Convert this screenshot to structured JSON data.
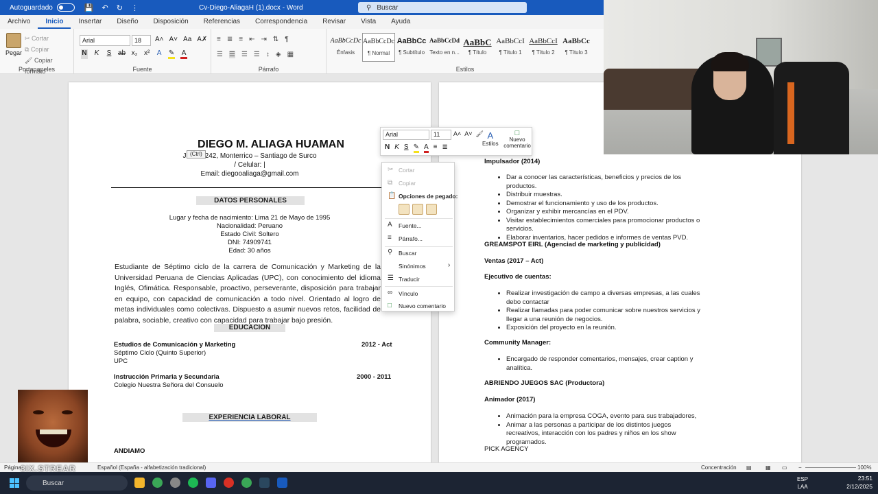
{
  "titlebar": {
    "autosave_label": "Autoguardado",
    "doc_title": "Cv-Diego-AliagaH (1).docx  -  Word",
    "search_placeholder": "Buscar"
  },
  "tabs": [
    "Archivo",
    "Inicio",
    "Insertar",
    "Diseño",
    "Disposición",
    "Referencias",
    "Correspondencia",
    "Revisar",
    "Vista",
    "Ayuda"
  ],
  "active_tab": "Inicio",
  "ribbon": {
    "clipboard": {
      "paste": "Pegar",
      "cut": "Cortar",
      "copy": "Copiar",
      "format_painter": "Copiar formato",
      "label": "Portapapeles"
    },
    "font": {
      "name": "Arial",
      "size": "18",
      "label": "Fuente",
      "buttons": [
        "N",
        "K",
        "S",
        "ab",
        "x₂",
        "x²",
        "A",
        "A"
      ]
    },
    "paragraph": {
      "label": "Párrafo"
    },
    "styles": {
      "label": "Estilos",
      "items": [
        {
          "preview": "AaBbCcDc",
          "name": "Énfasis"
        },
        {
          "preview": "AaBbCcDc",
          "name": "¶ Normal"
        },
        {
          "preview": "AaBbCc",
          "name": "¶ Subtítulo"
        },
        {
          "preview": "AaBbCcDd",
          "name": "Texto en n..."
        },
        {
          "preview": "AaBbC",
          "name": "¶ Título"
        },
        {
          "preview": "AaBbCcI",
          "name": "¶ Título 1"
        },
        {
          "preview": "AaBbCcI",
          "name": "¶ Título 2"
        },
        {
          "preview": "AaBbCc",
          "name": "¶ Título 3"
        }
      ]
    }
  },
  "page1": {
    "name": "DIEGO M. ALIAGA HUAMAN",
    "address": "Jr. ...in 242, Monterrico – Santiago de Surco",
    "phone": "/ Celular: |",
    "email": "Email: diegooaliaga@gmail.com",
    "datos_title": "DATOS PERSONALES",
    "datos": [
      "Lugar y fecha de nacimiento: Lima 21 de Mayo de 1995",
      "Nacionalidad: Peruano",
      "Estado Civil: Soltero",
      "DNI: 74909741",
      "Edad: 30 años"
    ],
    "profile": "Estudiante de Séptimo ciclo de la carrera de Comunicación y Marketing de la Universidad Peruana de Ciencias Aplicadas (UPC), con conocimiento del idioma Inglés, Ofimática. Responsable, proactivo, perseverante, disposición para trabajar en equipo, con capacidad de comunicación a todo nivel. Orientado al logro de metas individuales como colectivas. Dispuesto a asumir nuevos retos, facilidad de palabra, sociable, creativo con capacidad para trabajar bajo presión.",
    "educacion_title": "EDUCACION",
    "edu1": {
      "title": "Estudios de Comunicación y Marketing",
      "years": "2012 - Act",
      "line2": "Séptimo Ciclo (Quinto Superior)",
      "line3": "UPC"
    },
    "edu2": {
      "title": "Instrucción Primaria y Secundaria",
      "years": "2000 - 2011",
      "line2": "Colegio Nuestra Señora del Consuelo"
    },
    "experiencia_title": "EXPERIENCIA  LABORAL",
    "andiamo": "ANDIAMO"
  },
  "page2": {
    "impulsador": "Impulsador (2014)",
    "impulsador_items": [
      "Dar a conocer las características, beneficios y precios de los productos.",
      "Distribuir muestras.",
      "Demostrar el funcionamiento y uso de los productos.",
      "Organizar y exhibir mercancías en el PDV.",
      "Visitar establecimientos comerciales para promocionar productos o servicios.",
      "Elaborar inventarios, hacer pedidos e informes de ventas PVD."
    ],
    "greamspot": "GREAMSPOT EIRL (Agenciad de marketing y publicidad)",
    "ventas": "Ventas (2017 – Act)",
    "ejecutivo": "Ejecutivo de cuentas:",
    "ejecutivo_items": [
      "Realizar investigación de campo a diversas empresas, a las cuales debo contactar",
      "Realizar llamadas para poder comunicar sobre nuestros servicios y llegar a una reunión de negocios.",
      "Exposición del proyecto en la reunión."
    ],
    "community": "Community Manager:",
    "community_items": [
      "Encargado de responder comentarios, mensajes, crear caption y analítica."
    ],
    "abriendo": "ABRIENDO JUEGOS SAC (Productora)",
    "animador": "Animador (2017)",
    "animador_items": [
      "Animación para la empresa COGA, evento para sus trabajadores,",
      "Animar a las personas a participar de los distintos juegos recreativos, interacción con los padres y niños en los show programados."
    ],
    "pick": "PICK AGENCY"
  },
  "minibar": {
    "font": "Arial",
    "size": "11",
    "estilos": "Estilos",
    "nuevo": "Nuevo comentario"
  },
  "paste_tag": "(Ctrl)",
  "context_menu": {
    "cut": "Cortar",
    "copy": "Copiar",
    "paste_options": "Opciones de pegado:",
    "font": "Fuente...",
    "paragraph": "Párrafo...",
    "search": "Buscar",
    "synonyms": "Sinónimos",
    "translate": "Traducir",
    "link": "Vínculo",
    "new_comment": "Nuevo comentario"
  },
  "statusbar": {
    "page": "Página",
    "language": "Español (España - alfabetización tradicional)",
    "focus": "Concentración",
    "zoom": "100%"
  },
  "taskbar": {
    "search": "Buscar",
    "lang1": "ESP",
    "lang2": "LAA",
    "time": "23:51",
    "date": "2/12/2025"
  },
  "watermark": "3IX.STREAR",
  "colors": {
    "word_blue": "#185abd",
    "taskbar": "#1c2433",
    "ribbon": "#f8f8f8"
  }
}
